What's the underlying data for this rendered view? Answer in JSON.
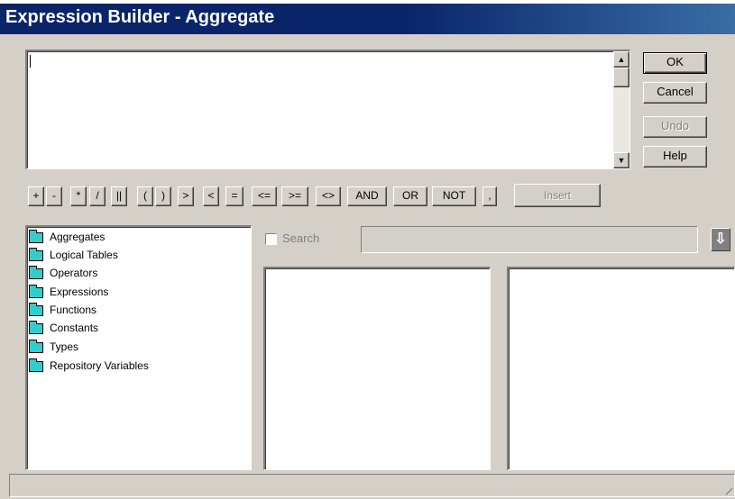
{
  "window": {
    "title": "Expression Builder - Aggregate"
  },
  "expression_text": "",
  "dialog_buttons": {
    "ok": "OK",
    "cancel": "Cancel",
    "undo": "Undo",
    "help": "Help"
  },
  "operators": [
    "+",
    "-",
    "*",
    "/",
    "||",
    "(",
    ")",
    ">",
    "<",
    "=",
    "<=",
    ">=",
    "<>",
    "AND",
    "OR",
    "NOT",
    ","
  ],
  "insert_label": "Insert",
  "tree": {
    "items": [
      {
        "label": "Aggregates"
      },
      {
        "label": "Logical Tables"
      },
      {
        "label": "Operators"
      },
      {
        "label": "Expressions"
      },
      {
        "label": "Functions"
      },
      {
        "label": "Constants"
      },
      {
        "label": "Types"
      },
      {
        "label": "Repository Variables"
      }
    ]
  },
  "search": {
    "label": "Search",
    "value": "",
    "checked": false
  },
  "icons": {
    "scroll_up": "arrow-up-icon",
    "scroll_down": "arrow-down-icon",
    "search_go": "down-arrow-icon",
    "folder": "folder-icon"
  },
  "colors": {
    "titlebar": "#0a246a",
    "window_bg": "#d4d0c8",
    "folder": "#33cccc"
  }
}
